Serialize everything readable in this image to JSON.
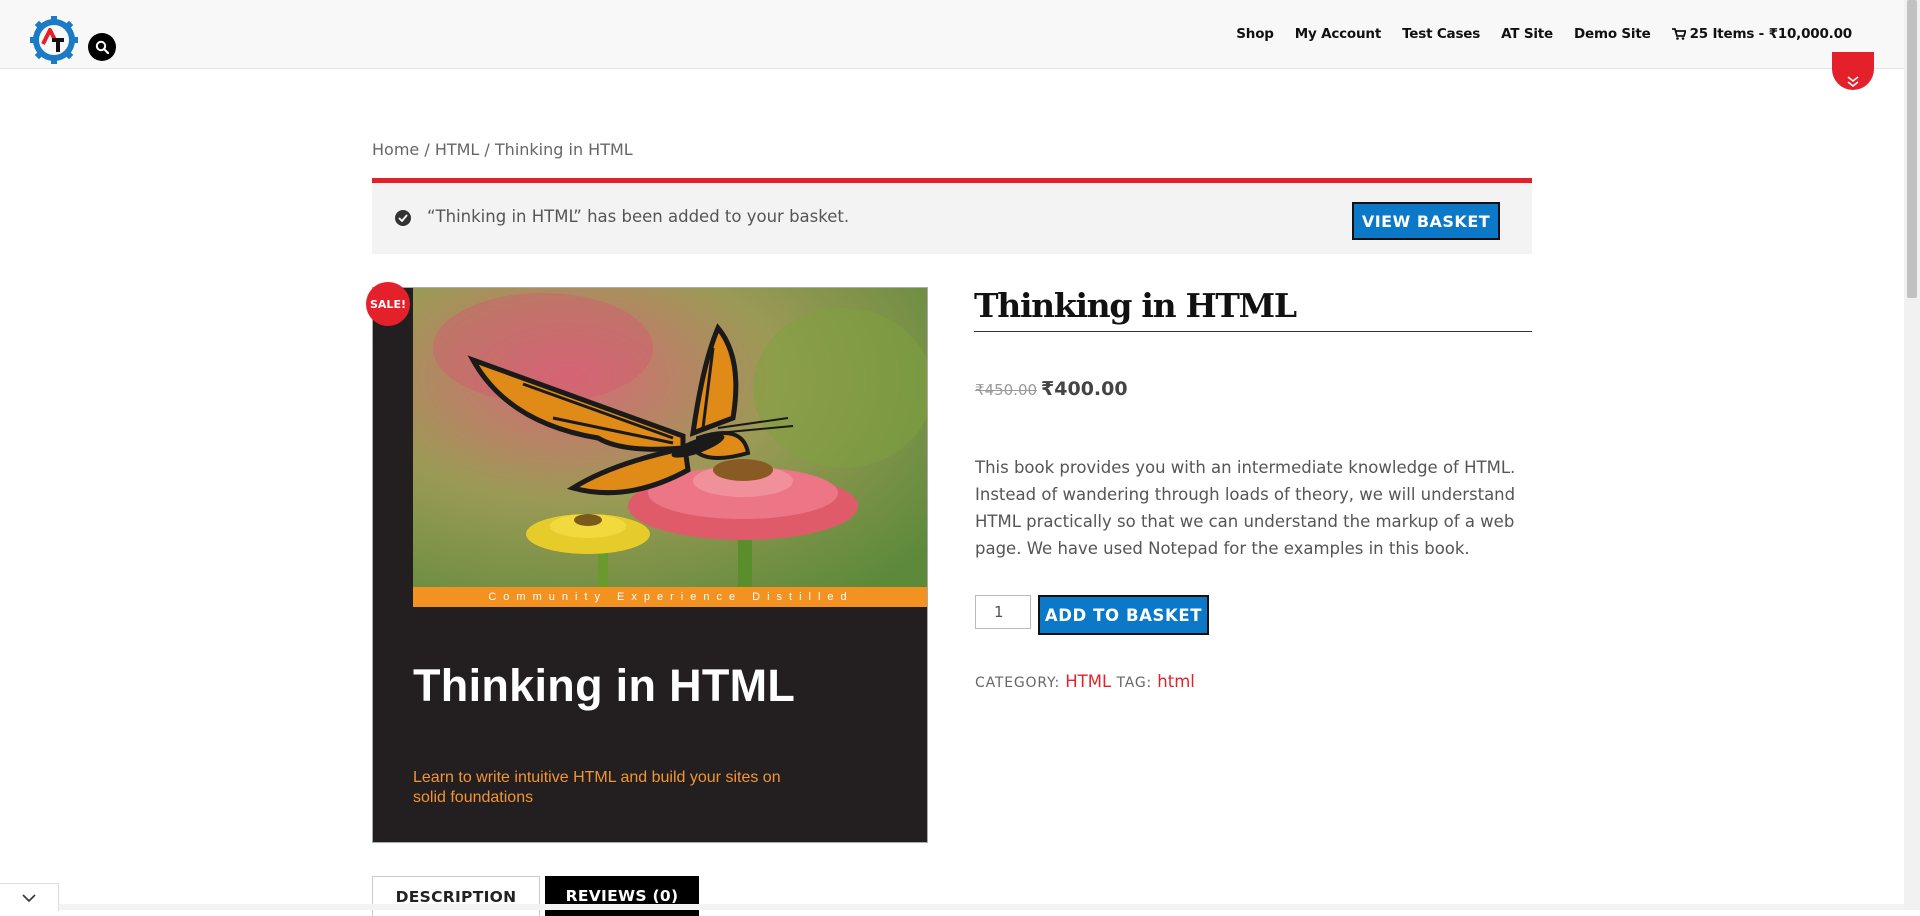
{
  "header": {
    "nav": [
      {
        "label": "Shop"
      },
      {
        "label": "My Account"
      },
      {
        "label": "Test Cases"
      },
      {
        "label": "AT Site"
      },
      {
        "label": "Demo Site"
      }
    ],
    "cart_label": "25 Items - ₹10,000.00"
  },
  "breadcrumb": {
    "home": "Home",
    "sep1": " / ",
    "category": "HTML",
    "sep2": " / ",
    "current": "Thinking in HTML"
  },
  "notice": {
    "message": "“Thinking in HTML” has been added to your basket.",
    "button": "VIEW BASKET"
  },
  "product": {
    "sale_badge": "SALE!",
    "cover": {
      "band_text": "Community Experience Distilled",
      "title": "Thinking in HTML",
      "subtitle": "Learn to write intuitive HTML and build your sites on solid foundations"
    },
    "title": "Thinking in HTML",
    "old_price": "₹450.00",
    "price": "₹400.00",
    "description": "This book provides you with an intermediate knowledge of HTML. Instead of wandering through loads of theory, we will understand HTML practically so that we can understand the markup of a web page. We have used Notepad for the examples in this book.",
    "quantity": "1",
    "add_button": "ADD TO BASKET",
    "category_label": "CATEGORY:",
    "category_value": "HTML",
    "tag_label": "TAG:",
    "tag_value": "html"
  },
  "tabs": [
    {
      "label": "DESCRIPTION"
    },
    {
      "label": "REVIEWS (0)"
    }
  ],
  "colors": {
    "accent_red": "#e4212b",
    "button_blue": "#0b78c8"
  },
  "icons": [
    "site-logo-icon",
    "search-icon",
    "cart-icon",
    "chevron-double-down-icon",
    "check-circle-icon",
    "chevron-down-icon"
  ]
}
